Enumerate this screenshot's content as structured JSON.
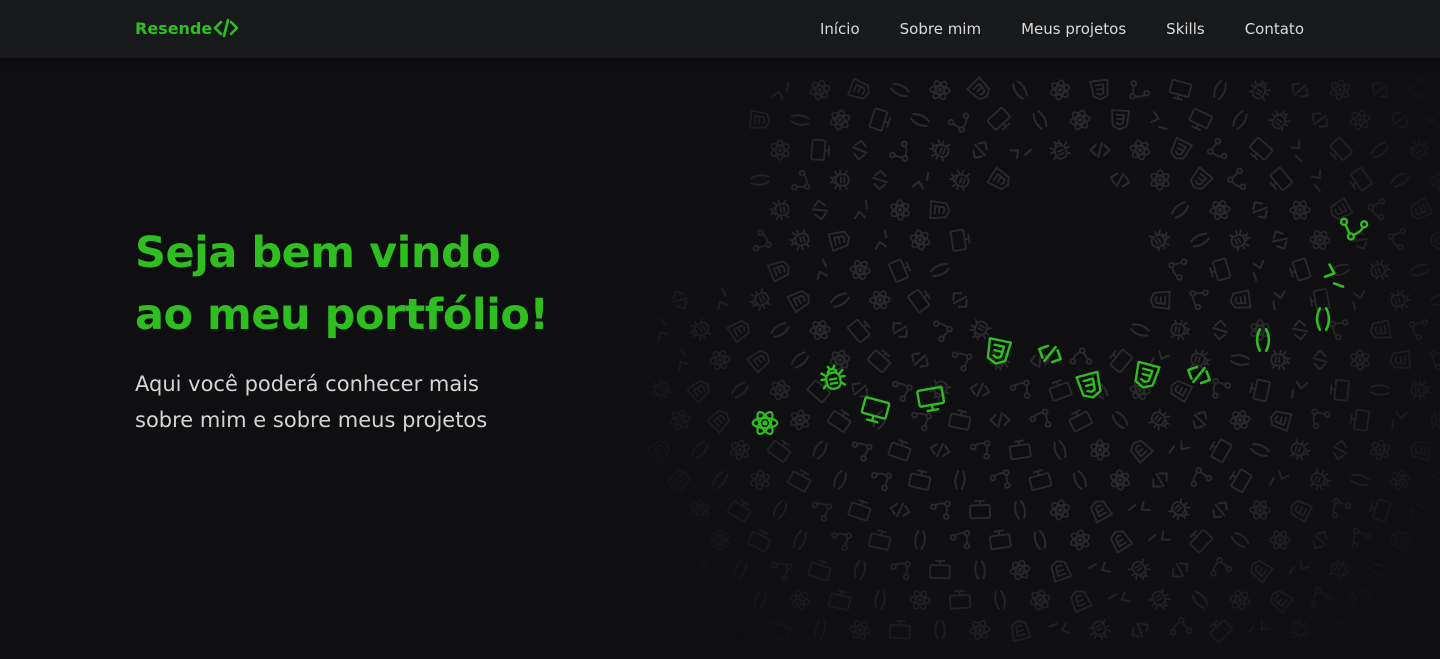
{
  "navbar": {
    "logo_text": "Resende",
    "logo_icon": "code-icon",
    "links": [
      "Início",
      "Sobre mim",
      "Meus projetos",
      "Skills",
      "Contato"
    ]
  },
  "hero": {
    "title_line1": "Seja bem vindo",
    "title_line2": "ao meu portfólio!",
    "subtitle_line1": "Aqui você poderá conhecer mais",
    "subtitle_line2": "sobre mim e sobre meus projetos"
  },
  "pattern_icons": [
    "react-icon",
    "bug-icon",
    "monitor-icon",
    "html5-icon",
    "code-icon",
    "parentheses-icon",
    "terminal-icon",
    "git-branch-icon"
  ],
  "colors": {
    "accent": "#2fbe1f",
    "background": "#0f0e10",
    "navbar": "#18191b",
    "text": "#d4d4d4",
    "pattern_dim": "#2a2a2d"
  }
}
